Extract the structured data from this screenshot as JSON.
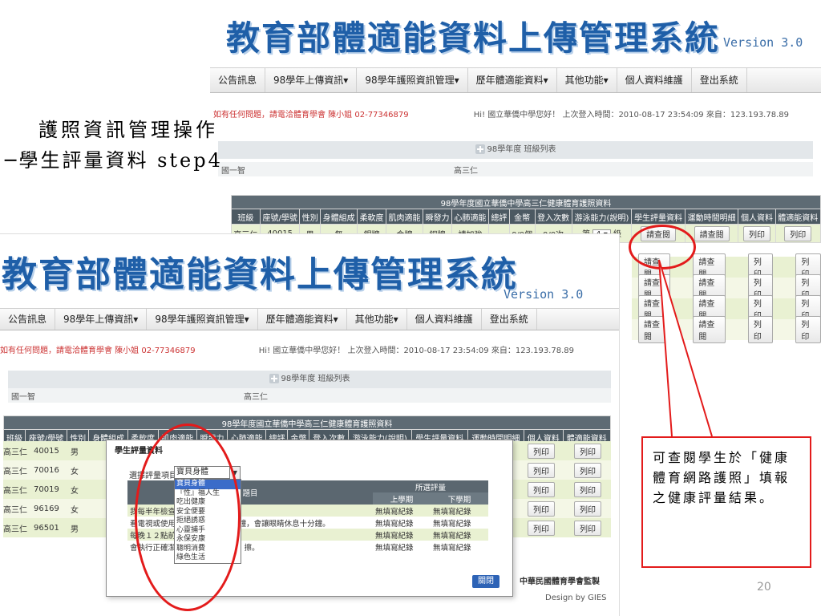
{
  "system_title": "教育部體適能資料上傳管理系統",
  "version": "Version 3.0",
  "menu": [
    "公告訊息",
    "98學年上傳資訊▾",
    "98學年護照資訊管理▾",
    "歷年體適能資料▾",
    "其他功能▾",
    "個人資料維護",
    "登出系統"
  ],
  "contact": "如有任何問題，請電洽體育學會 陳小姐 02-77346879",
  "welcome": "Hi! 國立華僑中學您好！ 上次登入時間：2010-08-17 23:54:09  來自：123.193.78.89",
  "class_list_title": "98學年度 班級列表",
  "class_row": [
    "國一智",
    "高三仁"
  ],
  "health_table_title": "98學年度國立華僑中學高三仁健康體育護照資料",
  "health_headers": [
    "班級",
    "座號/學號",
    "性別",
    "身體組成",
    "柔軟度",
    "肌肉適能",
    "瞬發力",
    "心肺適能",
    "總評",
    "金幣",
    "登入次數",
    "游泳能力(說明)",
    "學生評量資料",
    "運動時間明細",
    "個人資料",
    "體適能資料"
  ],
  "student_row1": {
    "class": "高三仁",
    "id": "40015",
    "sex": "男",
    "body": "無",
    "flex": "銀牌",
    "muscle": "金牌",
    "power": "銅牌",
    "cardio": "請加強",
    "total": "",
    "coins": "0/0個",
    "logins": "0/0次",
    "swim_prefix": "第",
    "swim_level": "4",
    "swim_suffix": "級"
  },
  "btn_view": "請查閱",
  "btn_print": "列印",
  "students": [
    {
      "class": "高三仁",
      "id": "40015",
      "sex": "男"
    },
    {
      "class": "高三仁",
      "id": "70016",
      "sex": "女"
    },
    {
      "class": "高三仁",
      "id": "70019",
      "sex": "女"
    },
    {
      "class": "高三仁",
      "id": "96169",
      "sex": "女"
    },
    {
      "class": "高三仁",
      "id": "96501",
      "sex": "男"
    }
  ],
  "lecture_title_1": "護照資訊管理操作",
  "lecture_title_2": "─學生評量資料  step4",
  "modal": {
    "title": "學生評量資料",
    "select_label": "選擇評量項目",
    "selected": "寶貝身體",
    "options": [
      "寶貝身體",
      "『性』福人生",
      "吃出健康",
      "安全便要",
      "拒絕誘惑",
      "心靈捕手",
      "永保安康",
      "聰明消費",
      "綠色生活"
    ],
    "col_topic": "題目",
    "col_eval": "所選評量",
    "col_sem1": "上學期",
    "col_sem2": "下學期",
    "questions": [
      {
        "q": "我每半年檢查",
        "s1": "無填寫紀錄",
        "s2": "無填寫紀錄"
      },
      {
        "q": "看電視或使用…………超過30分鐘，會讓眼睛休息十分鐘。",
        "s1": "無填寫紀錄",
        "s2": "無填寫紀錄"
      },
      {
        "q": "每晚１２點前",
        "s1": "無填寫紀錄",
        "s2": "無填寫紀錄"
      },
      {
        "q": "會執行正確潔牙…………沖、捧、擦。",
        "s1": "無填寫紀錄",
        "s2": "無填寫紀錄"
      }
    ],
    "close": "關閉"
  },
  "footer_org": "中華民國體育學會監製",
  "footer_design": "Design by GIES",
  "callout_text": "可查閱學生於「健康體育網路護照」填報之健康評量結果。",
  "page_number": "20",
  "colors": {
    "title_blue": "#1f5fa8",
    "annotation_red": "#e31b1b",
    "header_gray": "#4c5962",
    "row_green": "#e9f1d2"
  }
}
